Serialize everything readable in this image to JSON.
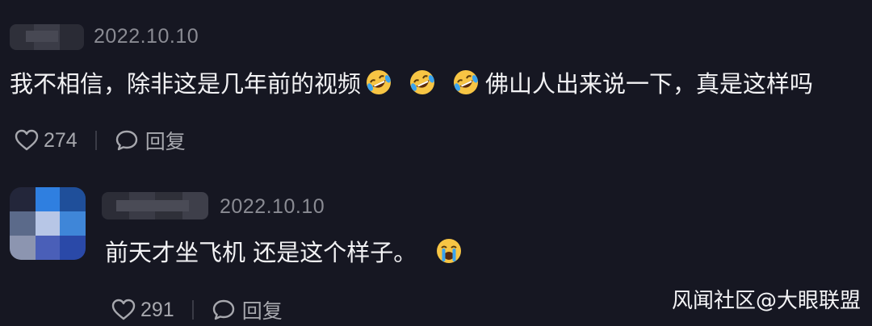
{
  "comments": [
    {
      "date": "2022.10.10",
      "text_before_emoji": "我不相信，除非这是几年前的视频",
      "emojis": [
        "rolling-on-floor-laughing-icon",
        "rolling-on-floor-laughing-icon",
        "rolling-on-floor-laughing-icon"
      ],
      "text_after_emoji": "佛山人出来说一下，真是这样吗",
      "likes": "274",
      "reply_label": "回复"
    },
    {
      "date": "2022.10.10",
      "text": "前天才坐飞机 还是这个样子。",
      "emojis": [
        "loudly-crying-face-icon"
      ],
      "likes": "291",
      "reply_label": "回复"
    }
  ],
  "watermark": "风闻社区@大眼联盟",
  "colors": {
    "background": "#161722",
    "text": "#f2f2f4",
    "muted": "#8a8b93",
    "emoji_yellow": "#f7c544",
    "tear_blue": "#3aa4ef"
  }
}
